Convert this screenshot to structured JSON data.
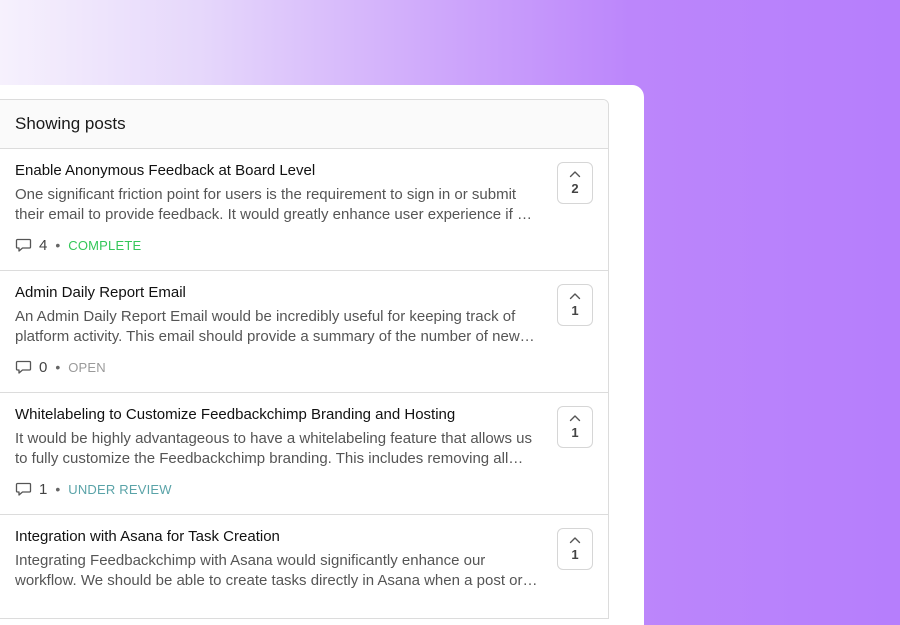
{
  "panel": {
    "header": "Showing posts"
  },
  "colors": {
    "complete": "#34c759",
    "open": "#9a9a9a",
    "under_review": "#5aa3a8"
  },
  "posts": [
    {
      "title": "Enable Anonymous Feedback at Board Level",
      "description": "One significant friction point for users is the requirement to sign in or submit their email to provide feedback. It would greatly enhance user experience if …",
      "comments": "4",
      "status": "COMPLETE",
      "status_color": "#34c759",
      "votes": "2",
      "icons": {
        "comment": "comment-icon",
        "upvote": "chevron-up-icon"
      }
    },
    {
      "title": "Admin Daily Report Email",
      "description": "An Admin Daily Report Email would be incredibly useful for keeping track of platform activity. This email should provide a summary of the number of new…",
      "comments": "0",
      "status": "OPEN",
      "status_color": "#9a9a9a",
      "votes": "1",
      "icons": {
        "comment": "comment-icon",
        "upvote": "chevron-up-icon"
      }
    },
    {
      "title": "Whitelabeling to Customize Feedbackchimp Branding and Hosting",
      "description": "It would be highly advantageous to have a whitelabeling feature that allows us to fully customize the Feedbackchimp branding. This includes removing all…",
      "comments": "1",
      "status": "UNDER REVIEW",
      "status_color": "#5aa3a8",
      "votes": "1",
      "icons": {
        "comment": "comment-icon",
        "upvote": "chevron-up-icon"
      }
    },
    {
      "title": "Integration with Asana for Task Creation",
      "description": "Integrating Feedbackchimp with Asana would significantly enhance our workflow. We should be able to create tasks directly in Asana when a post or…",
      "comments": "",
      "status": "",
      "status_color": "#9a9a9a",
      "votes": "1",
      "icons": {
        "comment": "comment-icon",
        "upvote": "chevron-up-icon"
      }
    }
  ]
}
